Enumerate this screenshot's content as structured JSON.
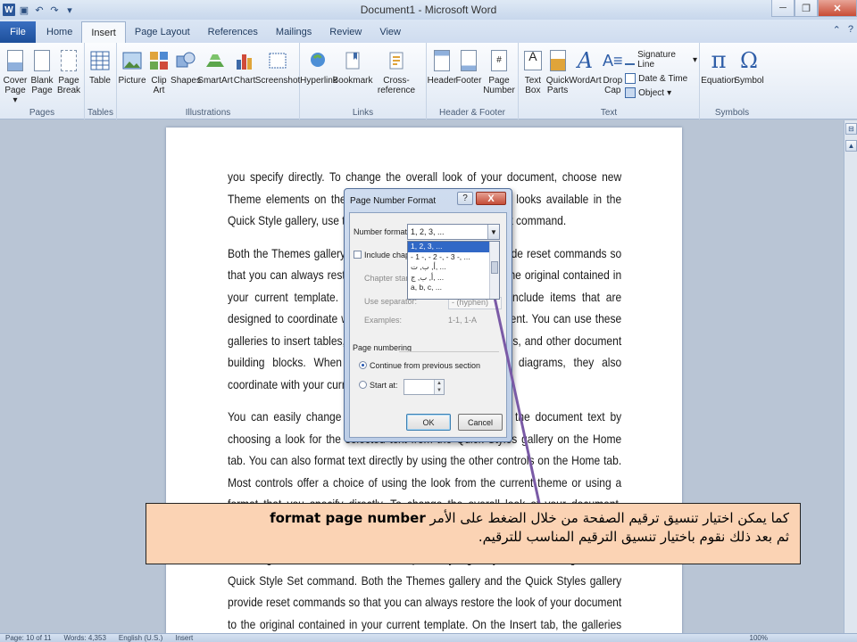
{
  "window": {
    "title": "Document1 - Microsoft Word",
    "qat_icons": [
      "word-icon",
      "save-icon",
      "undo-icon",
      "redo-icon",
      "customize-icon"
    ],
    "min_glyph": "─",
    "max_glyph": "❐",
    "close_glyph": "✕"
  },
  "tabs": [
    {
      "label": "File",
      "id": "file"
    },
    {
      "label": "Home",
      "id": "home"
    },
    {
      "label": "Insert",
      "id": "insert",
      "active": true
    },
    {
      "label": "Page Layout",
      "id": "page-layout"
    },
    {
      "label": "References",
      "id": "references"
    },
    {
      "label": "Mailings",
      "id": "mailings"
    },
    {
      "label": "Review",
      "id": "review"
    },
    {
      "label": "View",
      "id": "view"
    }
  ],
  "ribbon": {
    "pages": {
      "label": "Pages",
      "cover": "Cover Page ▾",
      "blank": "Blank Page",
      "break": "Page Break"
    },
    "tables": {
      "label": "Tables",
      "table": "Table"
    },
    "illustrations": {
      "label": "Illustrations",
      "picture": "Picture",
      "clipart": "Clip Art",
      "shapes": "Shapes",
      "smartart": "SmartArt",
      "chart": "Chart",
      "screenshot": "Screenshot"
    },
    "links": {
      "label": "Links",
      "hyperlink": "Hyperlink",
      "bookmark": "Bookmark",
      "crossref": "Cross-reference"
    },
    "headerfooter": {
      "label": "Header & Footer",
      "header": "Header",
      "footer": "Footer",
      "pagenumber": "Page Number"
    },
    "text": {
      "label": "Text",
      "textbox": "Text Box",
      "quickparts": "Quick Parts",
      "wordart": "WordArt",
      "dropcap": "Drop Cap",
      "sigline": "Signature Line",
      "datetime": "Date & Time",
      "object": "Object"
    },
    "symbols": {
      "label": "Symbols",
      "equation": "Equation",
      "symbol": "Symbol",
      "pi": "π",
      "omega": "Ω"
    }
  },
  "document": {
    "p1": "you specify directly. To change the overall look of your document, choose new Theme elements on the Page Layout tab. To change the looks available in the Quick Style gallery, use the Change Current Quick Style Set command.",
    "p2": "Both the Themes gallery and the Quick Styles gallery provide reset commands so that you can always restore the look of your document to the original contained in your current template. On the Insert tab, the galleries include items that are designed to coordinate with the overall look of your document. You can use these galleries to insert tables, headers, footers, lists, cover pages, and other document building blocks. When you create pictures, charts, or diagrams, they also coordinate with your current document look.",
    "p3": "You can easily change the formatting of selected text in the document text by choosing a look for the selected text from the Quick Styles gallery on the Home tab. You can also format text directly by using the other controls on the Home tab. Most controls offer a choice of using the look from the current theme or using a format that you specify directly. To change the overall look of your document, choose new Theme elements on the Page Layout tab.",
    "p4": "To change the looks available in the Quick Style gallery, use the Change Current Quick Style Set command. Both the Themes gallery and the Quick Styles gallery provide reset commands so that you can always restore the look of your document to the original contained in your current template. On the Insert tab, the galleries include items that"
  },
  "dialog": {
    "title": "Page Number Format",
    "help": "?",
    "close": "X",
    "number_format_label": "Number format:",
    "number_format_value": "1, 2, 3, ...",
    "options": [
      "1, 2, 3, ...",
      "- 1 -, - 2 -, - 3 -, ...",
      "أ, ب, ت, ...",
      "أ, ب, ج, ...",
      "a, b, c, ..."
    ],
    "include_chapter": "Include chapter number",
    "chapter_starts": "Chapter starts with style:",
    "use_separator": "Use separator:",
    "separator_value": "- (hyphen)",
    "examples_label": "Examples:",
    "examples_value": "1-1, 1-A",
    "page_numbering": "Page numbering",
    "continue": "Continue from previous section",
    "start_at": "Start at:",
    "ok": "OK",
    "cancel": "Cancel"
  },
  "status": {
    "page": "Page: 10 of 11",
    "words": "Words: 4,353",
    "language": "English (U.S.)",
    "mode": "Insert",
    "zoom": "100%"
  },
  "callout": {
    "line1_pre": "كما يمكن اختيار تنسيق ترقيم الصفحة من خلال الضغط على الأمر ",
    "line1_cmd": "format page number",
    "line2": "ثم بعد ذلك نقوم باختيار تنسيق الترقيم المناسب للترقيم."
  },
  "colors": {
    "accent": "#2b579a",
    "callout_bg": "#fbd3b4",
    "arrow": "#7a5aa6"
  }
}
